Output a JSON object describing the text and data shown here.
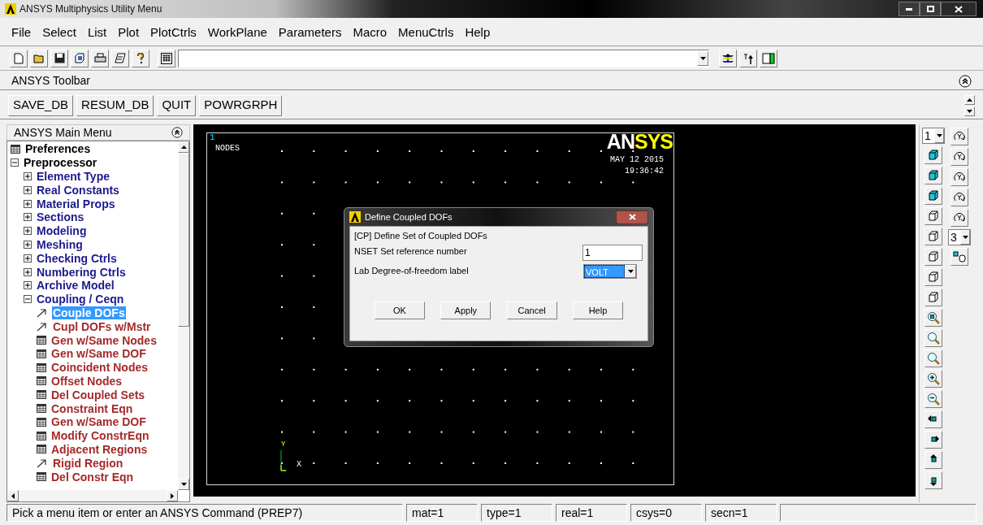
{
  "window": {
    "title": "ANSYS Multiphysics Utility Menu"
  },
  "menu": [
    "File",
    "Select",
    "List",
    "Plot",
    "PlotCtrls",
    "WorkPlane",
    "Parameters",
    "Macro",
    "MenuCtrls",
    "Help"
  ],
  "ansys_toolbar": {
    "title": "ANSYS Toolbar",
    "buttons": [
      "SAVE_DB",
      "RESUM_DB",
      "QUIT",
      "POWRGRPH"
    ]
  },
  "main_menu": {
    "title": "ANSYS Main Menu",
    "tree": [
      {
        "label": "Preferences",
        "kind": "command",
        "selected": false
      },
      {
        "label": "Preprocessor",
        "kind": "folder",
        "expanded": true,
        "selected": false,
        "children": [
          {
            "label": "Element Type",
            "kind": "folder",
            "expanded": false,
            "selected": false
          },
          {
            "label": "Real Constants",
            "kind": "folder",
            "expanded": false,
            "selected": false
          },
          {
            "label": "Material Props",
            "kind": "folder",
            "expanded": false,
            "selected": false
          },
          {
            "label": "Sections",
            "kind": "folder",
            "expanded": false,
            "selected": false
          },
          {
            "label": "Modeling",
            "kind": "folder",
            "expanded": false,
            "selected": false
          },
          {
            "label": "Meshing",
            "kind": "folder",
            "expanded": false,
            "selected": false
          },
          {
            "label": "Checking Ctrls",
            "kind": "folder",
            "expanded": false,
            "selected": false
          },
          {
            "label": "Numbering Ctrls",
            "kind": "folder",
            "expanded": false,
            "selected": false
          },
          {
            "label": "Archive Model",
            "kind": "folder",
            "expanded": false,
            "selected": false
          },
          {
            "label": "Coupling / Ceqn",
            "kind": "folder",
            "expanded": true,
            "selected": false,
            "children": [
              {
                "label": "Couple DOFs",
                "kind": "dialog",
                "selected": true
              },
              {
                "label": "Cupl DOFs w/Mstr",
                "kind": "dialog",
                "selected": false
              },
              {
                "label": "Gen w/Same Nodes",
                "kind": "command",
                "selected": false
              },
              {
                "label": "Gen w/Same DOF",
                "kind": "command",
                "selected": false
              },
              {
                "label": "Coincident Nodes",
                "kind": "command",
                "selected": false
              },
              {
                "label": "Offset Nodes",
                "kind": "command",
                "selected": false
              },
              {
                "label": "Del Coupled Sets",
                "kind": "command",
                "selected": false
              },
              {
                "label": "Constraint Eqn",
                "kind": "command",
                "selected": false
              },
              {
                "label": "Gen w/Same DOF",
                "kind": "command",
                "selected": false
              },
              {
                "label": "Modify ConstrEqn",
                "kind": "command",
                "selected": false
              },
              {
                "label": "Adjacent Regions",
                "kind": "command",
                "selected": false
              },
              {
                "label": "Rigid Region",
                "kind": "dialog",
                "selected": false
              },
              {
                "label": "Del Constr Eqn",
                "kind": "command",
                "selected": false
              }
            ]
          }
        ]
      }
    ]
  },
  "graphics": {
    "window_number": "1",
    "label": "NODES",
    "logo": [
      "AN",
      "SYS"
    ],
    "date": "MAY 12 2015",
    "time": "19:36:42",
    "axis_y": "Y",
    "axis_x": "X"
  },
  "dialog": {
    "title": "Define Coupled DOFs",
    "heading": "[CP]  Define Set of Coupled DOFs",
    "fields": [
      {
        "kind": "text",
        "code": "NSET",
        "label": "Set reference number",
        "value": "1"
      },
      {
        "kind": "select",
        "code": "Lab",
        "label": "Degree-of-freedom label",
        "value": "VOLT"
      }
    ],
    "buttons": [
      "OK",
      "Apply",
      "Cancel",
      "Help"
    ]
  },
  "view_toolbar": {
    "window_select": "1",
    "direction_select": "3"
  },
  "status_bar": [
    "Pick a menu item or enter an ANSYS Command (PREP7)",
    "mat=1",
    "type=1",
    "real=1",
    "csys=0",
    "secn=1"
  ]
}
